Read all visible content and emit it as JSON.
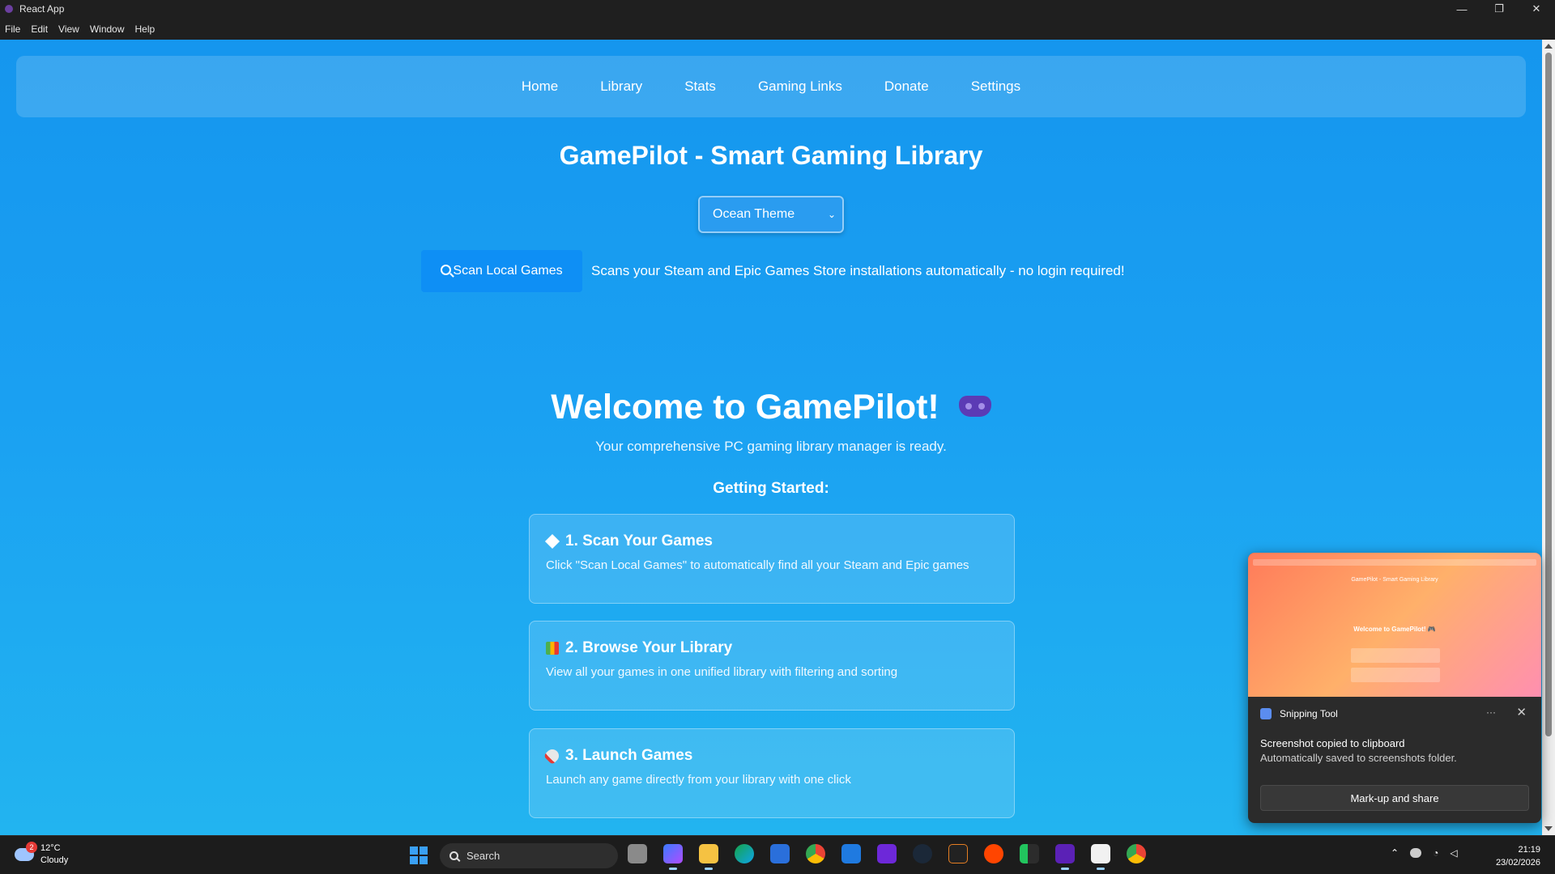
{
  "window": {
    "title": "React App",
    "controls": [
      "—",
      "❐",
      "✕"
    ]
  },
  "menu": [
    "File",
    "Edit",
    "View",
    "Window",
    "Help"
  ],
  "nav": [
    "Home",
    "Library",
    "Stats",
    "Gaming Links",
    "Donate",
    "Settings"
  ],
  "header": {
    "title": "GamePilot - Smart Gaming Library"
  },
  "theme_select": {
    "selected": "Ocean Theme"
  },
  "scan": {
    "button_label": "Scan Local Games",
    "description": "Scans your Steam and Epic Games Store installations automatically - no login required!"
  },
  "welcome": {
    "title": "Welcome to GamePilot!",
    "subtitle": "Your comprehensive PC gaming library manager is ready.",
    "getting_started": "Getting Started:"
  },
  "cards": [
    {
      "title": "1. Scan Your Games",
      "desc": "Click \"Scan Local Games\" to automatically find all your Steam and Epic games",
      "icon": "unknown-glyph-icon"
    },
    {
      "title": "2. Browse Your Library",
      "desc": "View all your games in one unified library with filtering and sorting",
      "icon": "books-icon"
    },
    {
      "title": "3. Launch Games",
      "desc": "Launch any game directly from your library with one click",
      "icon": "rocket-icon"
    }
  ],
  "notification": {
    "app": "Snipping Tool",
    "more": "···",
    "message": "Screenshot copied to clipboard",
    "detail": "Automatically saved to screenshots folder.",
    "action": "Mark-up and share",
    "preview": {
      "title": "GamePilot - Smart Gaming Library",
      "welcome": "Welcome to GamePilot! 🎮"
    }
  },
  "taskbar": {
    "weather": {
      "temp": "12°C",
      "condition": "Cloudy",
      "badge": "2"
    },
    "search_placeholder": "Search",
    "clock": {
      "time": "21:19",
      "date": "23/02/2026"
    }
  },
  "colors": {
    "app_bg": "#1596ee",
    "scan_button": "#0e8ff5",
    "taskbar": "#1c1c1c",
    "notification": "#2b2b2b"
  }
}
